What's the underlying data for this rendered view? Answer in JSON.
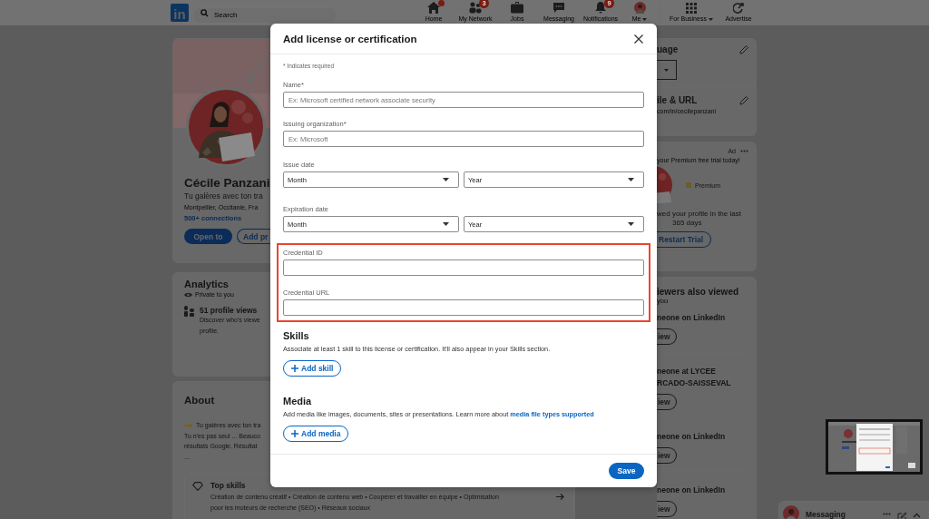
{
  "nav": {
    "logo": "in",
    "search": {
      "placeholder": "Search"
    },
    "items": [
      {
        "kind": "home",
        "label": "Home",
        "alert": true,
        "dropdown": false
      },
      {
        "kind": "network",
        "label": "My Network",
        "badge": "3",
        "alert": false,
        "dropdown": false
      },
      {
        "kind": "jobs",
        "label": "Jobs",
        "alert": false,
        "dropdown": false
      },
      {
        "kind": "messaging",
        "label": "Messaging",
        "alert": false,
        "dropdown": false
      },
      {
        "kind": "notifications",
        "label": "Notifications",
        "badge": "9",
        "alert": false,
        "dropdown": false
      },
      {
        "kind": "me",
        "label": "Me",
        "alert": false,
        "dropdown": true
      }
    ],
    "business": [
      {
        "kind": "apps",
        "label": "For Business",
        "dropdown": true
      },
      {
        "kind": "advertise",
        "label": "Advertise",
        "dropdown": false
      }
    ]
  },
  "profile": {
    "name": "Cécile Panzani",
    "headline": "Tu galères avec ton tra",
    "location": "Montpellier, Occitanie, Fra",
    "connections": "500+ connections",
    "buttons": [
      {
        "label": "Open to",
        "kind": "primary"
      },
      {
        "label": "Add pr",
        "kind": "outline"
      }
    ]
  },
  "analytics": {
    "title": "Analytics",
    "privacy": "Private to you",
    "views": "51 profile views",
    "description": [
      "Discover who's viewe",
      "profile."
    ]
  },
  "about": {
    "title": "About",
    "lines": [
      "Tu galères avec ton tra",
      "Tu n'es pas seul ... Beauco",
      "résultats Google. Résultat",
      "..."
    ],
    "top_skills": {
      "title": "Top skills",
      "lines": [
        "Création de contenu créatif • Création de contenu web • Coopérer et travailler en équipe • Optimisation",
        "pour les moteurs de recherche (SEO) • Réseaux sociaux"
      ]
    }
  },
  "right": {
    "language": {
      "title": "uage"
    },
    "profile_url": {
      "title": "ile & URL",
      "url": "com/in/cecilepanzani"
    },
    "ad": {
      "label": "Ad",
      "text": "your Premium free trial today!",
      "premium": "Premium",
      "viewed": [
        "wed your profile in the last",
        "365 days"
      ],
      "button": "Restart Trial"
    },
    "viewers": {
      "title": "iewers also viewed",
      "subtitle": "you",
      "people": [
        {
          "lines": [
            "neone on LinkedIn"
          ],
          "button": "iew"
        },
        {
          "lines": [
            "neone at LYCEE",
            "RCADO-SAISSEVAL"
          ],
          "button": "iew"
        },
        {
          "lines": [
            "neone on LinkedIn"
          ],
          "button": "iew"
        },
        {
          "lines": [
            "neone on LinkedIn"
          ],
          "button": "iew"
        }
      ]
    }
  },
  "modal": {
    "title": "Add license or certification",
    "required_note": "* Indicates required",
    "fields": [
      {
        "kind": "text",
        "label": "Name*",
        "placeholder": "Ex: Microsoft certified network associate security"
      },
      {
        "kind": "text",
        "label": "Issuing organization*",
        "placeholder": "Ex: Microsoft"
      },
      {
        "kind": "date",
        "label": "Issue date",
        "month": "Month",
        "year": "Year"
      },
      {
        "kind": "date",
        "label": "Expiration date",
        "month": "Month",
        "year": "Year"
      }
    ],
    "highlighted_fields": [
      {
        "kind": "text",
        "label": "Credential ID"
      },
      {
        "kind": "text",
        "label": "Credential URL"
      }
    ],
    "sections": [
      {
        "heading": "Skills",
        "text": "Associate at least 1 skill to this license or certification. It'll also appear in your Skills section.",
        "button": "Add skill"
      },
      {
        "heading": "Media",
        "text": "Add media like images, documents, sites or presentations. Learn more about ",
        "link": "media file types supported",
        "button": "Add media"
      }
    ],
    "save": "Save"
  },
  "messaging": {
    "label": "Messaging"
  }
}
